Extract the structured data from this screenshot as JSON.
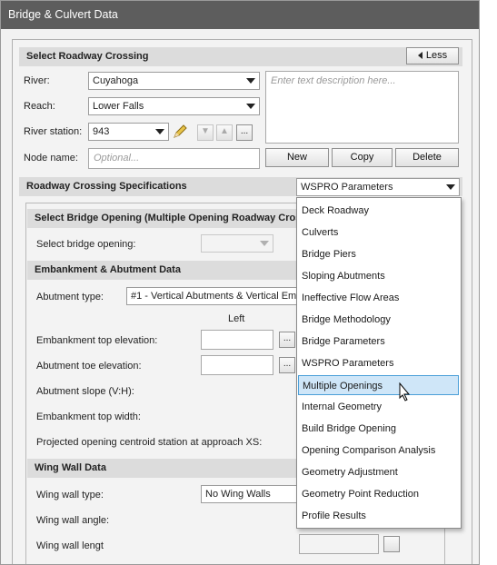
{
  "window": {
    "title": "Bridge & Culvert Data"
  },
  "roadway_crossing": {
    "section_title": "Select Roadway Crossing",
    "less_button": "Less",
    "river_label": "River:",
    "river_value": "Cuyahoga",
    "reach_label": "Reach:",
    "reach_value": "Lower Falls",
    "station_label": "River station:",
    "station_value": "943",
    "node_label": "Node name:",
    "node_placeholder": "Optional...",
    "description_placeholder": "Enter text description here...",
    "new_button": "New",
    "copy_button": "Copy",
    "delete_button": "Delete"
  },
  "specs": {
    "section_title": "Roadway Crossing Specifications",
    "selected": "WSPRO Parameters",
    "options": [
      "Deck Roadway",
      "Culverts",
      "Bridge Piers",
      "Sloping Abutments",
      "Ineffective Flow Areas",
      "Bridge Methodology",
      "Bridge Parameters",
      "WSPRO Parameters",
      "Multiple Openings",
      "Internal Geometry",
      "Build Bridge Opening",
      "Opening Comparison Analysis",
      "Geometry Adjustment",
      "Geometry Point Reduction",
      "Profile Results"
    ],
    "highlighted": "Multiple Openings"
  },
  "panel": {
    "opening_section": "Select Bridge Opening (Multiple Opening Roadway Crossi",
    "select_opening_label": "Select bridge opening:",
    "embankment_section": "Embankment & Abutment Data",
    "abutment_type_label": "Abutment type:",
    "abutment_type_value": "#1 - Vertical Abutments & Vertical Em",
    "left_header": "Left",
    "embankment_top_label": "Embankment top elevation:",
    "abutment_toe_label": "Abutment toe elevation:",
    "abutment_slope_label": "Abutment slope (V:H):",
    "embankment_width_label": "Embankment top width:",
    "centroid_label": "Projected opening centroid station at approach XS:",
    "wingwall_section": "Wing Wall Data",
    "wingwall_type_label": "Wing wall type:",
    "wingwall_type_value": "No Wing Walls",
    "wingwall_angle_label": "Wing wall angle:",
    "wingwall_length_label": "Wing wall lengt"
  },
  "icons": [
    "pencil-icon",
    "triangle-down-icon",
    "triangle-up-icon",
    "ellipsis-icon",
    "cursor-icon"
  ]
}
